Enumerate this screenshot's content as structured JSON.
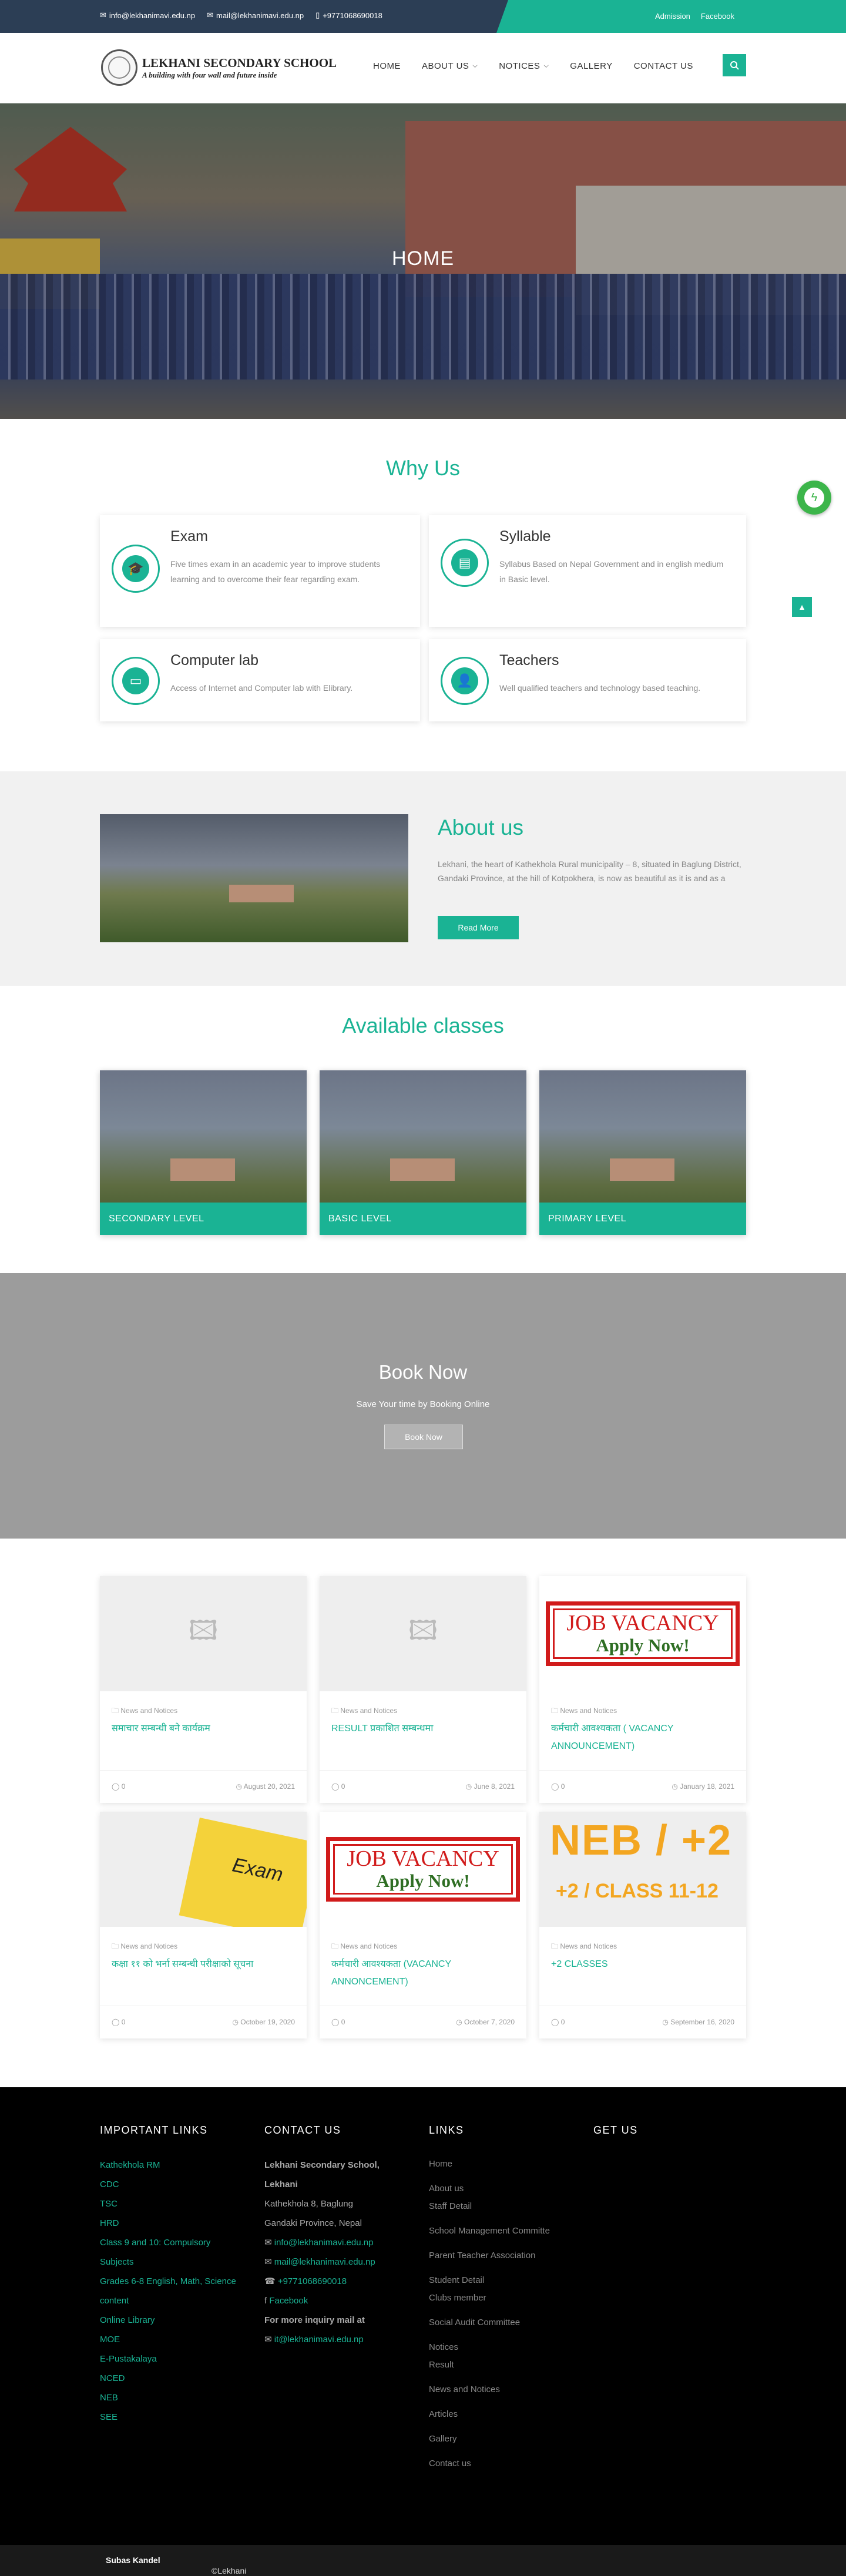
{
  "topbar": {
    "email1": "info@lekhanimavi.edu.np",
    "email2": "mail@lekhanimavi.edu.np",
    "phone": "+9771068690018",
    "link_admission": "Admission",
    "link_facebook": "Facebook"
  },
  "logo": {
    "name": "LEKHANI SECONDARY SCHOOL",
    "tagline": "A building with four wall and future inside"
  },
  "menu": [
    "HOME",
    "ABOUT US",
    "NOTICES",
    "GALLERY",
    "CONTACT US"
  ],
  "hero": {
    "title": "HOME"
  },
  "why": {
    "title": "Why Us",
    "cards": [
      {
        "title": "Exam",
        "text": "Five times exam in an academic year to improve students learning and to overcome their fear regarding exam.",
        "icon": "graduation-cap-icon"
      },
      {
        "title": "Syllable",
        "text": "Syllabus Based on Nepal Government and in english medium in Basic level.",
        "icon": "book-icon"
      },
      {
        "title": "Computer lab",
        "text": "Access of Internet and Computer lab with Elibrary.",
        "icon": "monitor-icon"
      },
      {
        "title": "Teachers",
        "text": "Well qualified teachers and technology based teaching.",
        "icon": "user-icon"
      }
    ]
  },
  "about": {
    "title": "About us",
    "text": "Lekhani, the heart of Kathekhola Rural municipality – 8, situated in Baglung District, Gandaki Province, at the hill of Kotpokhera, is now as beautiful as it is and as a",
    "button": "Read More"
  },
  "classes": {
    "title": "Available classes",
    "items": [
      "SECONDARY LEVEL",
      "BASIC LEVEL",
      "PRIMARY LEVEL"
    ]
  },
  "book": {
    "title": "Book Now",
    "subtitle": "Save Your time by Booking Online",
    "button": "Book Now"
  },
  "news": [
    {
      "category": "News and Notices",
      "title": "समाचार सम्बन्धी बने कार्यक्रम",
      "comments": "0",
      "date": "August 20, 2021"
    },
    {
      "category": "News and Notices",
      "title": "RESULT प्रकाशित सम्बन्धमा",
      "comments": "0",
      "date": "June 8, 2021"
    },
    {
      "category": "News and Notices",
      "title": "कर्मचारी आवश्यकता ( VACANCY ANNOUNCEMENT)",
      "comments": "0",
      "date": "January 18, 2021"
    },
    {
      "category": "News and Notices",
      "title": "कक्षा ११ को भर्ना सम्बन्धी परीक्षाको सूचना",
      "comments": "0",
      "date": "October 19, 2020"
    },
    {
      "category": "News and Notices",
      "title": "कर्मचारी आवश्यकता (VACANCY ANNONCEMENT)",
      "comments": "0",
      "date": "October 7, 2020"
    },
    {
      "category": "News and Notices",
      "title": "+2 CLASSES",
      "comments": "0",
      "date": "September 16, 2020"
    }
  ],
  "job_vacancy": {
    "line1": "JOB VACANCY",
    "line2": "Apply Now!"
  },
  "exam_word": "Exam",
  "neb": {
    "line1": "NEB / +2",
    "line2": "+2 / CLASS 11-12"
  },
  "footer": {
    "important_title": "IMPORTANT LINKS",
    "important_links": [
      "Kathekhola RM",
      "CDC",
      "TSC",
      "HRD",
      "Class 9 and 10: Compulsory",
      "Subjects",
      "Grades 6-8 English, Math, Science",
      "content",
      "Online Library",
      "MOE",
      "E-Pustakalaya",
      "NCED",
      "NEB",
      "SEE"
    ],
    "contact_title": "CONTACT US",
    "contact_name": "Lekhani Secondary School,",
    "contact_name2": "Lekhani",
    "contact_addr1": "Kathekhola 8, Baglung",
    "contact_addr2": "Gandaki Province, Nepal",
    "contact_email1": "info@lekhanimavi.edu.np",
    "contact_email2": "mail@lekhanimavi.edu.np",
    "contact_phone": "+9771068690018",
    "contact_facebook": "Facebook",
    "contact_more": "For more inquiry mail at",
    "contact_more_email": "it@lekhanimavi.edu.np",
    "links_title": "LINKS",
    "links": [
      "Home",
      "About us",
      "Staff Detail",
      "School Management Committe",
      "Parent Teacher Association",
      "Student Detail",
      "Clubs member",
      "Social Audit Committee",
      "Notices",
      "Result",
      "News and Notices",
      "Articles",
      "Gallery",
      "Contact us"
    ],
    "getus_title": "GET US"
  },
  "copyright": {
    "text": "©Lekhani Secondary School. All Right Reserved | Site By ",
    "author": "Subas Kandel"
  },
  "colors": {
    "accent": "#1ab394",
    "topbar": "#2c3e55"
  }
}
